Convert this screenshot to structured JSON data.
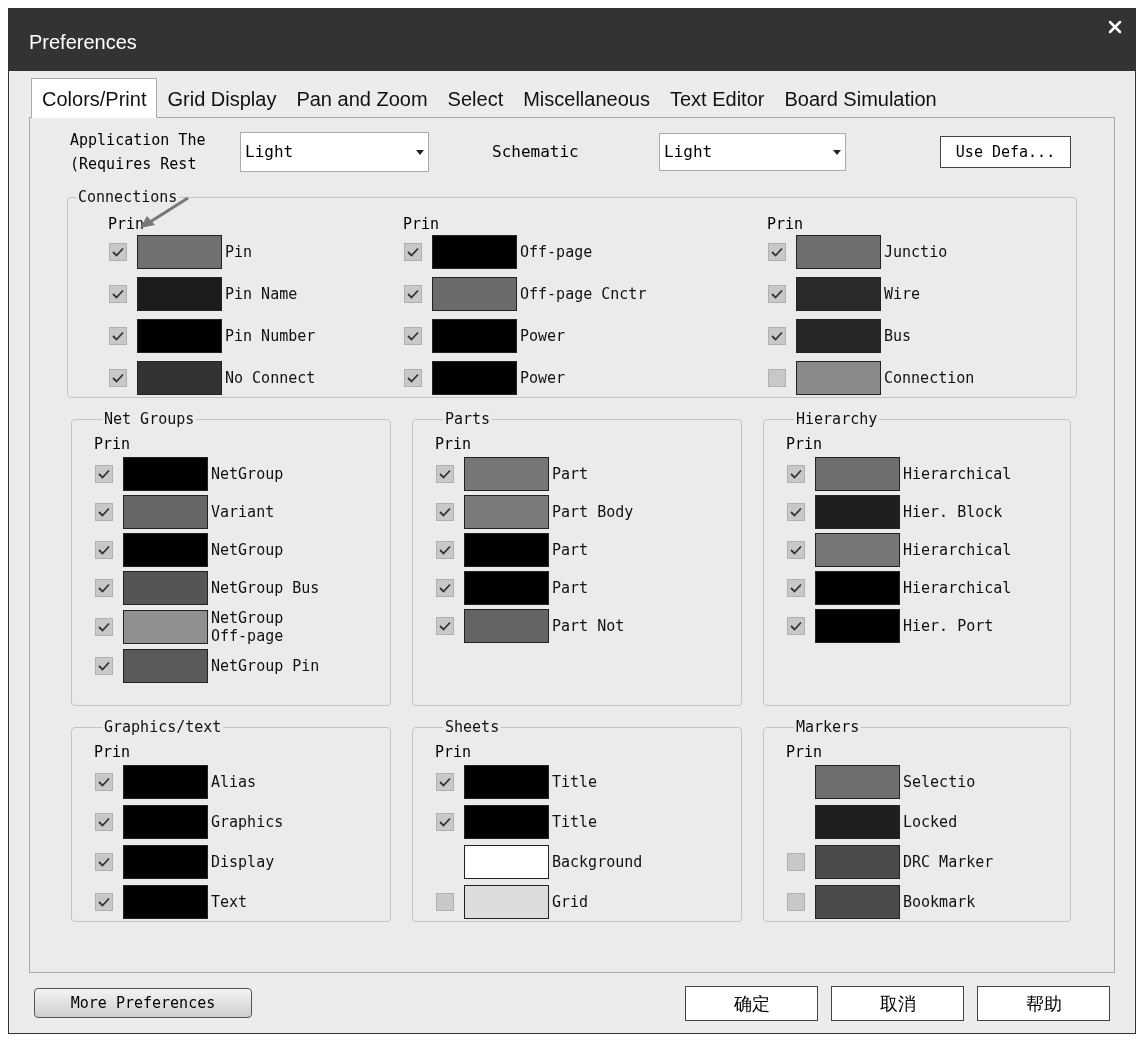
{
  "window": {
    "title": "Preferences"
  },
  "tabs": [
    {
      "label": "Colors/Print",
      "selected": true
    },
    {
      "label": "Grid Display",
      "selected": false
    },
    {
      "label": "Pan and Zoom",
      "selected": false
    },
    {
      "label": "Select",
      "selected": false
    },
    {
      "label": "Miscellaneous",
      "selected": false
    },
    {
      "label": "Text Editor",
      "selected": false
    },
    {
      "label": "Board Simulation",
      "selected": false
    }
  ],
  "theme": {
    "label_lines": [
      "Application The",
      "(Requires Rest"
    ],
    "value": "Light"
  },
  "schematic": {
    "label": "Schematic",
    "value": "Light"
  },
  "use_defaults_button": "Use Defa...",
  "connections": {
    "title": "Connections",
    "columns": [
      {
        "header": "Prin",
        "items": [
          {
            "label": "Pin",
            "checked": true,
            "color": "#707070"
          },
          {
            "label": "Pin Name",
            "checked": true,
            "color": "#1c1c1c"
          },
          {
            "label": "Pin Number",
            "checked": true,
            "color": "#000000"
          },
          {
            "label": "No Connect",
            "checked": true,
            "color": "#333333"
          }
        ]
      },
      {
        "header": "Prin",
        "items": [
          {
            "label": "Off-page",
            "checked": true,
            "color": "#000000"
          },
          {
            "label": "Off-page Cnctr",
            "checked": true,
            "color": "#6b6b6b"
          },
          {
            "label": "Power",
            "checked": true,
            "color": "#000000"
          },
          {
            "label": "Power",
            "checked": true,
            "color": "#000000"
          }
        ]
      },
      {
        "header": "Prin",
        "items": [
          {
            "label": "Junctio",
            "checked": true,
            "color": "#6e6e6e"
          },
          {
            "label": "Wire",
            "checked": true,
            "color": "#2a2a2a"
          },
          {
            "label": "Bus",
            "checked": true,
            "color": "#262626"
          },
          {
            "label": "Connection",
            "checked": false,
            "color": "#8a8a8a"
          }
        ]
      }
    ]
  },
  "groups": [
    {
      "title": "Net Groups",
      "header": "Prin",
      "items": [
        {
          "label": "NetGroup",
          "checked": true,
          "color": "#000000"
        },
        {
          "label": "Variant",
          "checked": true,
          "color": "#666666"
        },
        {
          "label": "NetGroup",
          "checked": true,
          "color": "#000000"
        },
        {
          "label": "NetGroup Bus",
          "checked": true,
          "color": "#555555"
        },
        {
          "label": "NetGroup\nOff-page",
          "checked": true,
          "color": "#909090"
        },
        {
          "label": "NetGroup Pin",
          "checked": true,
          "color": "#5a5a5a"
        }
      ]
    },
    {
      "title": "Parts",
      "header": "Prin",
      "items": [
        {
          "label": "Part",
          "checked": true,
          "color": "#777777"
        },
        {
          "label": "Part Body",
          "checked": true,
          "color": "#7a7a7a"
        },
        {
          "label": "Part",
          "checked": true,
          "color": "#000000"
        },
        {
          "label": "Part",
          "checked": true,
          "color": "#000000"
        },
        {
          "label": "Part Not",
          "checked": true,
          "color": "#646464"
        }
      ]
    },
    {
      "title": "Hierarchy",
      "header": "Prin",
      "items": [
        {
          "label": "Hierarchical",
          "checked": true,
          "color": "#6e6e6e"
        },
        {
          "label": "Hier. Block",
          "checked": true,
          "color": "#1e1e1e"
        },
        {
          "label": "Hierarchical",
          "checked": true,
          "color": "#777777"
        },
        {
          "label": "Hierarchical",
          "checked": true,
          "color": "#000000"
        },
        {
          "label": "Hier. Port",
          "checked": true,
          "color": "#000000"
        }
      ]
    },
    {
      "title": "Graphics/text",
      "header": "Prin",
      "items": [
        {
          "label": "Alias",
          "checked": true,
          "color": "#000000"
        },
        {
          "label": "Graphics",
          "checked": true,
          "color": "#000000"
        },
        {
          "label": "Display",
          "checked": true,
          "color": "#000000"
        },
        {
          "label": "Text",
          "checked": true,
          "color": "#000000"
        }
      ]
    },
    {
      "title": "Sheets",
      "header": "Prin",
      "items": [
        {
          "label": "Title",
          "checked": true,
          "color": "#000000"
        },
        {
          "label": "Title",
          "checked": true,
          "color": "#000000"
        },
        {
          "label": "Background",
          "color": "#ffffff"
        },
        {
          "label": "Grid",
          "checked": false,
          "color": "#dcdcdc"
        }
      ]
    },
    {
      "title": "Markers",
      "header": "Prin",
      "items": [
        {
          "label": "Selectio",
          "color": "#6e6e6e"
        },
        {
          "label": "Locked",
          "color": "#1e1e1e"
        },
        {
          "label": "DRC Marker",
          "checked": false,
          "color": "#4a4a4a"
        },
        {
          "label": "Bookmark",
          "checked": false,
          "color": "#4a4a4a"
        }
      ]
    }
  ],
  "more_button": "More Preferences",
  "buttons": [
    "确定",
    "取消",
    "帮助"
  ]
}
